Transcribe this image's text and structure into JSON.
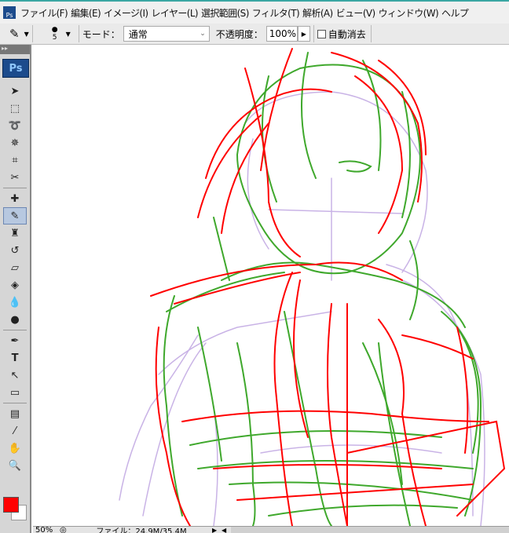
{
  "menu": [
    "ファイル(F)",
    "編集(E)",
    "イメージ(I)",
    "レイヤー(L)",
    "選択範囲(S)",
    "フィルタ(T)",
    "解析(A)",
    "ビュー(V)",
    "ウィンドウ(W)",
    "ヘルプ"
  ],
  "options": {
    "brush_size": "5",
    "mode_label": "モード：",
    "mode_value": "通常",
    "opacity_label": "不透明度：",
    "opacity_value": "100%",
    "auto_erase_label": "自動消去"
  },
  "toolbox": {
    "logo": "Ps",
    "foreground": "#ff0000",
    "background": "#ffffff"
  },
  "status": {
    "zoom": "50%",
    "file_info": "ファイル：24.9M/35.4M"
  },
  "colors": {
    "red_stroke": "#ff0000",
    "green_stroke": "#3fa82c",
    "purple_stroke": "#c9b3e6"
  }
}
